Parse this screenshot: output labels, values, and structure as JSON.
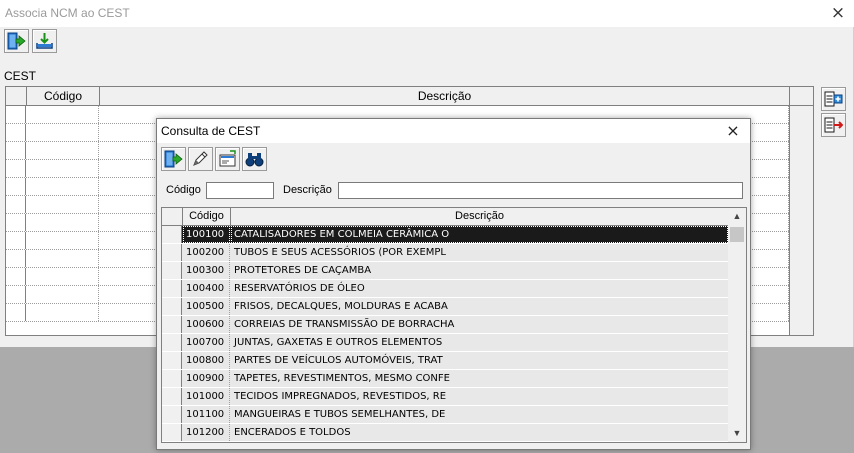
{
  "main": {
    "title": "Associa NCM ao CEST",
    "close_glyph": "×",
    "toolbar": {
      "exit_icon": "exit-door-icon",
      "import_icon": "import-tray-icon"
    },
    "section_label": "CEST",
    "grid": {
      "columns": [
        "Código",
        "Descrição"
      ],
      "empty_rows": 12
    },
    "side_buttons": {
      "add_icon": "add-item-icon",
      "remove_icon": "remove-item-icon"
    }
  },
  "dialog": {
    "title": "Consulta de CEST",
    "close_glyph": "×",
    "toolbar": {
      "exit_icon": "exit-door-icon",
      "edit_icon": "pencil-icon",
      "card_icon": "card-return-icon",
      "search_icon": "binoculars-icon"
    },
    "filter": {
      "codigo_label": "Código",
      "codigo_value": "",
      "descricao_label": "Descrição",
      "descricao_value": ""
    },
    "grid": {
      "columns": [
        "Código",
        "Descrição"
      ],
      "selected_index": 0,
      "rows": [
        {
          "codigo": "100100",
          "descricao": "CATALISADORES EM COLMEIA CERÂMICA O"
        },
        {
          "codigo": "100200",
          "descricao": "TUBOS E SEUS ACESSÓRIOS (POR EXEMPL"
        },
        {
          "codigo": "100300",
          "descricao": "PROTETORES DE CAÇAMBA"
        },
        {
          "codigo": "100400",
          "descricao": "RESERVATÓRIOS DE ÓLEO"
        },
        {
          "codigo": "100500",
          "descricao": "FRISOS, DECALQUES, MOLDURAS E ACABA"
        },
        {
          "codigo": "100600",
          "descricao": "CORREIAS DE TRANSMISSÃO DE BORRACHA"
        },
        {
          "codigo": "100700",
          "descricao": "JUNTAS, GAXETAS E OUTROS ELEMENTOS"
        },
        {
          "codigo": "100800",
          "descricao": "PARTES DE VEÍCULOS AUTOMÓVEIS, TRAT"
        },
        {
          "codigo": "100900",
          "descricao": "TAPETES, REVESTIMENTOS, MESMO CONFE"
        },
        {
          "codigo": "101000",
          "descricao": "TECIDOS IMPREGNADOS, REVESTIDOS, RE"
        },
        {
          "codigo": "101100",
          "descricao": "MANGUEIRAS E TUBOS SEMELHANTES, DE"
        },
        {
          "codigo": "101200",
          "descricao": "ENCERADOS E TOLDOS"
        }
      ]
    }
  }
}
